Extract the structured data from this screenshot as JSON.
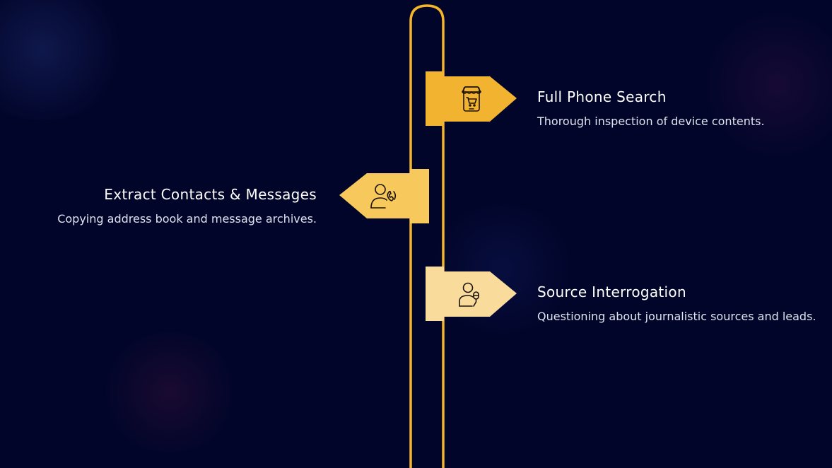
{
  "colors": {
    "background": "#02052a",
    "outline": "#f5b52a",
    "step1": "#f2b330",
    "step2": "#f7c95d",
    "step3": "#f9dc9c",
    "icon": "#1a1208"
  },
  "steps": [
    {
      "title": "Full Phone Search",
      "description": "Thorough inspection of device contents.",
      "icon": "mobile-shop-icon"
    },
    {
      "title": "Extract Contacts & Messages",
      "description": "Copying address book and message archives.",
      "icon": "person-phone-icon"
    },
    {
      "title": "Source Interrogation",
      "description": "Questioning about journalistic sources and leads.",
      "icon": "reporter-microphone-icon"
    }
  ]
}
